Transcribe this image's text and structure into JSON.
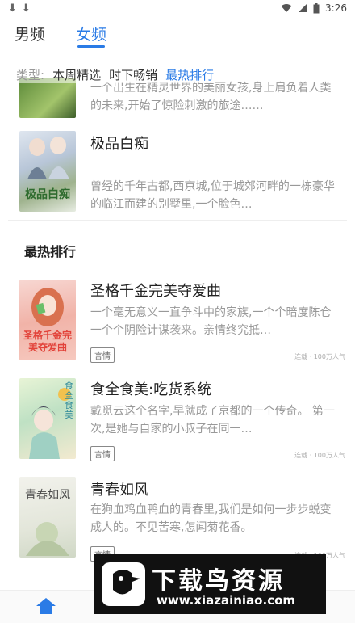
{
  "status_bar": {
    "time": "3:26"
  },
  "tabs": [
    {
      "label": "男频"
    },
    {
      "label": "女频"
    }
  ],
  "filter": {
    "label": "类型:",
    "options": [
      {
        "label": "本周精选"
      },
      {
        "label": "时下畅销"
      },
      {
        "label": "最热排行"
      }
    ]
  },
  "top_books": [
    {
      "desc": "一个出生在精灵世界的美丽女孩,身上肩负着人类的未来,开始了惊险刺激的旅途……"
    },
    {
      "title": "极品白痴",
      "desc": "曾经的千年古都,西京城,位于城郊河畔的一栋豪华的临江而建的别墅里,一个脸色…",
      "cover_text": "极品白痴"
    }
  ],
  "section": {
    "title": "最热排行"
  },
  "hot_books": [
    {
      "title": "圣格千金完美夺爱曲",
      "desc": "一个毫无意义一直争斗中的家族,一个个暗度陈仓一个个阴险计谋袭来。亲情终究抵…",
      "tag": "言情",
      "meta": "连载 · 100万人气",
      "cover_text": "圣格千金完美夺爱曲"
    },
    {
      "title": "食全食美:吃货系统",
      "desc": "戴觅云这个名字,早就成了京都的一个传奇。 第一次,是她与自家的小叔子在同一…",
      "tag": "言情",
      "meta": "连载 · 100万人气",
      "cover_text": "食全食美"
    },
    {
      "title": "青春如风",
      "desc": "在狗血鸡血鸭血的青春里,我们是如何一步步蜕变成人的。不见苦寒,怎闻菊花香。",
      "tag": "言情",
      "meta": "连载 · 100万人气",
      "cover_text": "青春如风"
    }
  ],
  "watermark": {
    "text": "下载鸟资源",
    "url": "www.xiazainiao.com"
  }
}
